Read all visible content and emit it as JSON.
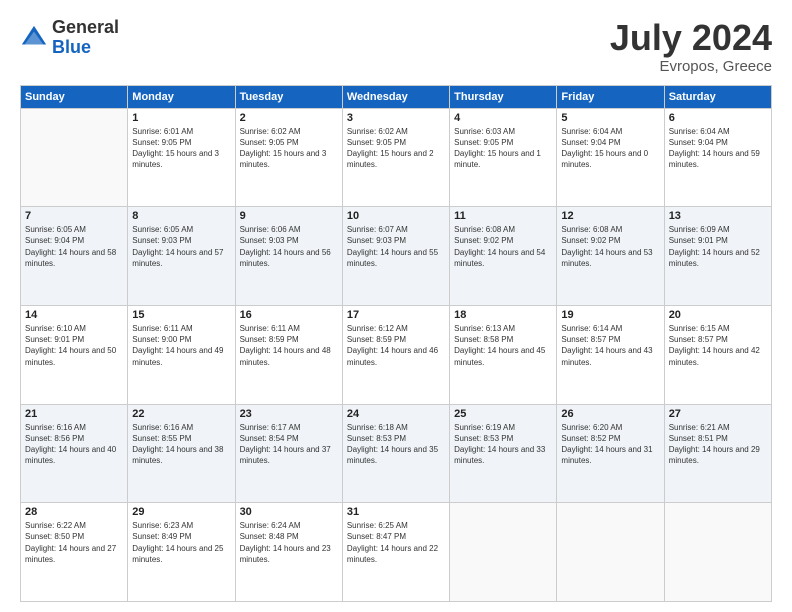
{
  "header": {
    "logo_general": "General",
    "logo_blue": "Blue",
    "month": "July 2024",
    "location": "Evropos, Greece"
  },
  "weekdays": [
    "Sunday",
    "Monday",
    "Tuesday",
    "Wednesday",
    "Thursday",
    "Friday",
    "Saturday"
  ],
  "weeks": [
    [
      {
        "day": "",
        "sunrise": "",
        "sunset": "",
        "daylight": ""
      },
      {
        "day": "1",
        "sunrise": "Sunrise: 6:01 AM",
        "sunset": "Sunset: 9:05 PM",
        "daylight": "Daylight: 15 hours and 3 minutes."
      },
      {
        "day": "2",
        "sunrise": "Sunrise: 6:02 AM",
        "sunset": "Sunset: 9:05 PM",
        "daylight": "Daylight: 15 hours and 3 minutes."
      },
      {
        "day": "3",
        "sunrise": "Sunrise: 6:02 AM",
        "sunset": "Sunset: 9:05 PM",
        "daylight": "Daylight: 15 hours and 2 minutes."
      },
      {
        "day": "4",
        "sunrise": "Sunrise: 6:03 AM",
        "sunset": "Sunset: 9:05 PM",
        "daylight": "Daylight: 15 hours and 1 minute."
      },
      {
        "day": "5",
        "sunrise": "Sunrise: 6:04 AM",
        "sunset": "Sunset: 9:04 PM",
        "daylight": "Daylight: 15 hours and 0 minutes."
      },
      {
        "day": "6",
        "sunrise": "Sunrise: 6:04 AM",
        "sunset": "Sunset: 9:04 PM",
        "daylight": "Daylight: 14 hours and 59 minutes."
      }
    ],
    [
      {
        "day": "7",
        "sunrise": "Sunrise: 6:05 AM",
        "sunset": "Sunset: 9:04 PM",
        "daylight": "Daylight: 14 hours and 58 minutes."
      },
      {
        "day": "8",
        "sunrise": "Sunrise: 6:05 AM",
        "sunset": "Sunset: 9:03 PM",
        "daylight": "Daylight: 14 hours and 57 minutes."
      },
      {
        "day": "9",
        "sunrise": "Sunrise: 6:06 AM",
        "sunset": "Sunset: 9:03 PM",
        "daylight": "Daylight: 14 hours and 56 minutes."
      },
      {
        "day": "10",
        "sunrise": "Sunrise: 6:07 AM",
        "sunset": "Sunset: 9:03 PM",
        "daylight": "Daylight: 14 hours and 55 minutes."
      },
      {
        "day": "11",
        "sunrise": "Sunrise: 6:08 AM",
        "sunset": "Sunset: 9:02 PM",
        "daylight": "Daylight: 14 hours and 54 minutes."
      },
      {
        "day": "12",
        "sunrise": "Sunrise: 6:08 AM",
        "sunset": "Sunset: 9:02 PM",
        "daylight": "Daylight: 14 hours and 53 minutes."
      },
      {
        "day": "13",
        "sunrise": "Sunrise: 6:09 AM",
        "sunset": "Sunset: 9:01 PM",
        "daylight": "Daylight: 14 hours and 52 minutes."
      }
    ],
    [
      {
        "day": "14",
        "sunrise": "Sunrise: 6:10 AM",
        "sunset": "Sunset: 9:01 PM",
        "daylight": "Daylight: 14 hours and 50 minutes."
      },
      {
        "day": "15",
        "sunrise": "Sunrise: 6:11 AM",
        "sunset": "Sunset: 9:00 PM",
        "daylight": "Daylight: 14 hours and 49 minutes."
      },
      {
        "day": "16",
        "sunrise": "Sunrise: 6:11 AM",
        "sunset": "Sunset: 8:59 PM",
        "daylight": "Daylight: 14 hours and 48 minutes."
      },
      {
        "day": "17",
        "sunrise": "Sunrise: 6:12 AM",
        "sunset": "Sunset: 8:59 PM",
        "daylight": "Daylight: 14 hours and 46 minutes."
      },
      {
        "day": "18",
        "sunrise": "Sunrise: 6:13 AM",
        "sunset": "Sunset: 8:58 PM",
        "daylight": "Daylight: 14 hours and 45 minutes."
      },
      {
        "day": "19",
        "sunrise": "Sunrise: 6:14 AM",
        "sunset": "Sunset: 8:57 PM",
        "daylight": "Daylight: 14 hours and 43 minutes."
      },
      {
        "day": "20",
        "sunrise": "Sunrise: 6:15 AM",
        "sunset": "Sunset: 8:57 PM",
        "daylight": "Daylight: 14 hours and 42 minutes."
      }
    ],
    [
      {
        "day": "21",
        "sunrise": "Sunrise: 6:16 AM",
        "sunset": "Sunset: 8:56 PM",
        "daylight": "Daylight: 14 hours and 40 minutes."
      },
      {
        "day": "22",
        "sunrise": "Sunrise: 6:16 AM",
        "sunset": "Sunset: 8:55 PM",
        "daylight": "Daylight: 14 hours and 38 minutes."
      },
      {
        "day": "23",
        "sunrise": "Sunrise: 6:17 AM",
        "sunset": "Sunset: 8:54 PM",
        "daylight": "Daylight: 14 hours and 37 minutes."
      },
      {
        "day": "24",
        "sunrise": "Sunrise: 6:18 AM",
        "sunset": "Sunset: 8:53 PM",
        "daylight": "Daylight: 14 hours and 35 minutes."
      },
      {
        "day": "25",
        "sunrise": "Sunrise: 6:19 AM",
        "sunset": "Sunset: 8:53 PM",
        "daylight": "Daylight: 14 hours and 33 minutes."
      },
      {
        "day": "26",
        "sunrise": "Sunrise: 6:20 AM",
        "sunset": "Sunset: 8:52 PM",
        "daylight": "Daylight: 14 hours and 31 minutes."
      },
      {
        "day": "27",
        "sunrise": "Sunrise: 6:21 AM",
        "sunset": "Sunset: 8:51 PM",
        "daylight": "Daylight: 14 hours and 29 minutes."
      }
    ],
    [
      {
        "day": "28",
        "sunrise": "Sunrise: 6:22 AM",
        "sunset": "Sunset: 8:50 PM",
        "daylight": "Daylight: 14 hours and 27 minutes."
      },
      {
        "day": "29",
        "sunrise": "Sunrise: 6:23 AM",
        "sunset": "Sunset: 8:49 PM",
        "daylight": "Daylight: 14 hours and 25 minutes."
      },
      {
        "day": "30",
        "sunrise": "Sunrise: 6:24 AM",
        "sunset": "Sunset: 8:48 PM",
        "daylight": "Daylight: 14 hours and 23 minutes."
      },
      {
        "day": "31",
        "sunrise": "Sunrise: 6:25 AM",
        "sunset": "Sunset: 8:47 PM",
        "daylight": "Daylight: 14 hours and 22 minutes."
      },
      {
        "day": "",
        "sunrise": "",
        "sunset": "",
        "daylight": ""
      },
      {
        "day": "",
        "sunrise": "",
        "sunset": "",
        "daylight": ""
      },
      {
        "day": "",
        "sunrise": "",
        "sunset": "",
        "daylight": ""
      }
    ]
  ]
}
